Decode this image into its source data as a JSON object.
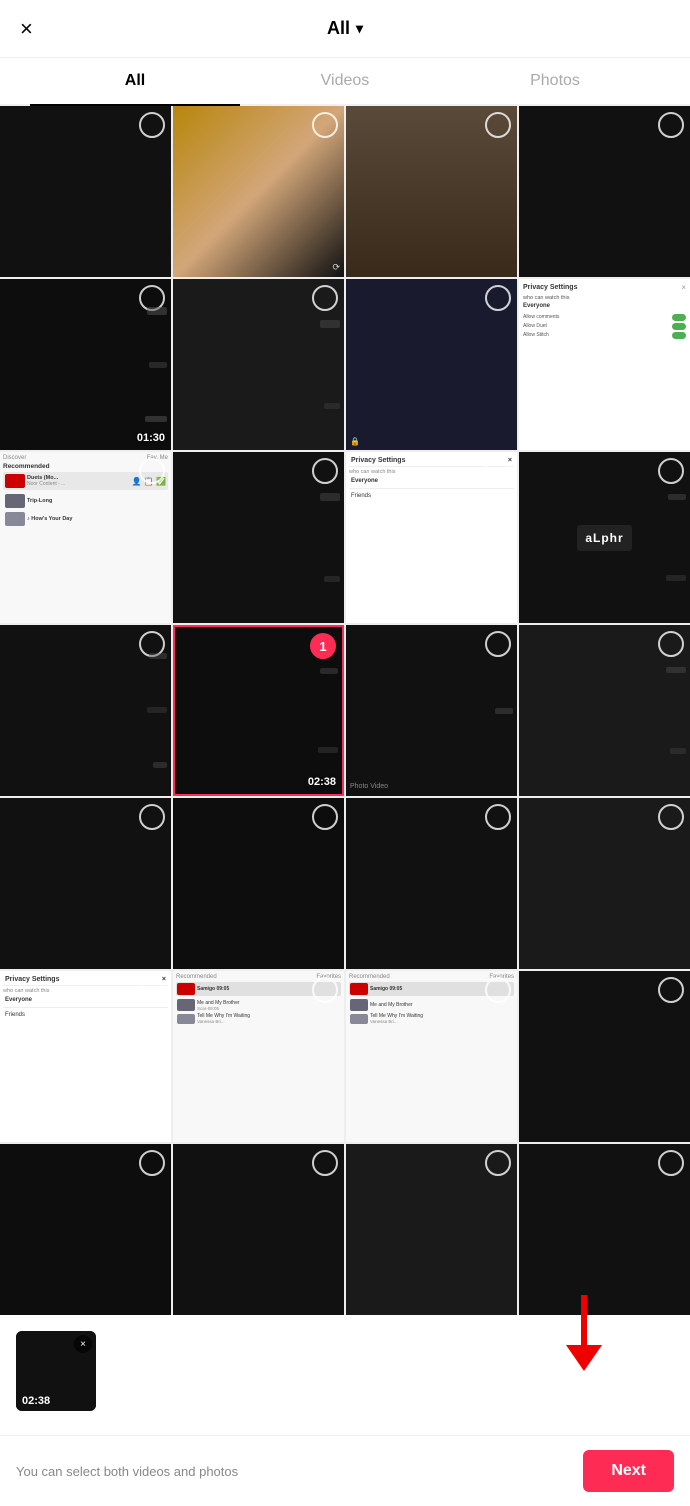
{
  "header": {
    "close_icon": "×",
    "title": "All",
    "chevron": "▾"
  },
  "tabs": [
    {
      "label": "All",
      "active": true
    },
    {
      "label": "Videos",
      "active": false
    },
    {
      "label": "Photos",
      "active": false
    }
  ],
  "grid": {
    "cells": [
      {
        "id": 0,
        "type": "dark",
        "selected": false,
        "duration": null
      },
      {
        "id": 1,
        "type": "face",
        "selected": false,
        "duration": null
      },
      {
        "id": 2,
        "type": "face2",
        "selected": false,
        "duration": null
      },
      {
        "id": 3,
        "type": "empty",
        "selected": false,
        "duration": null
      },
      {
        "id": 4,
        "type": "dark",
        "selected": false,
        "duration": "01:30"
      },
      {
        "id": 5,
        "type": "dark",
        "selected": false,
        "duration": null
      },
      {
        "id": 6,
        "type": "dark",
        "selected": false,
        "duration": null
      },
      {
        "id": 7,
        "type": "privacy1",
        "selected": false,
        "duration": null
      },
      {
        "id": 8,
        "type": "discover",
        "selected": false,
        "duration": null
      },
      {
        "id": 9,
        "type": "dark",
        "selected": false,
        "duration": null
      },
      {
        "id": 10,
        "type": "privacy2",
        "selected": false,
        "duration": null
      },
      {
        "id": 11,
        "type": "alphr",
        "selected": false,
        "duration": null
      },
      {
        "id": 12,
        "type": "dark",
        "selected": false,
        "duration": null
      },
      {
        "id": 13,
        "type": "dark-selected",
        "selected": true,
        "number": 1,
        "duration": "02:38"
      },
      {
        "id": 14,
        "type": "dark",
        "selected": false,
        "duration": null
      },
      {
        "id": 15,
        "type": "dark",
        "selected": false,
        "duration": null
      },
      {
        "id": 16,
        "type": "dark",
        "selected": false,
        "duration": null
      },
      {
        "id": 17,
        "type": "dark",
        "selected": false,
        "duration": null
      },
      {
        "id": 18,
        "type": "dark",
        "selected": false,
        "duration": null
      },
      {
        "id": 19,
        "type": "dark",
        "selected": false,
        "duration": null
      },
      {
        "id": 20,
        "type": "privacy3",
        "selected": false,
        "duration": null
      },
      {
        "id": 21,
        "type": "discover2",
        "selected": false,
        "duration": null
      },
      {
        "id": 22,
        "type": "discover3",
        "selected": false,
        "duration": null
      },
      {
        "id": 23,
        "type": "dark",
        "selected": false,
        "duration": null
      },
      {
        "id": 24,
        "type": "dark",
        "selected": false,
        "duration": null
      },
      {
        "id": 25,
        "type": "dark",
        "selected": false,
        "duration": null
      },
      {
        "id": 26,
        "type": "dark",
        "selected": false,
        "duration": null
      },
      {
        "id": 27,
        "type": "dark",
        "selected": false,
        "duration": null
      }
    ]
  },
  "preview": {
    "duration": "02:38",
    "close_icon": "×"
  },
  "bottom_bar": {
    "hint": "You can select both videos and photos",
    "next_label": "Next"
  },
  "arrow": {
    "visible": true
  }
}
